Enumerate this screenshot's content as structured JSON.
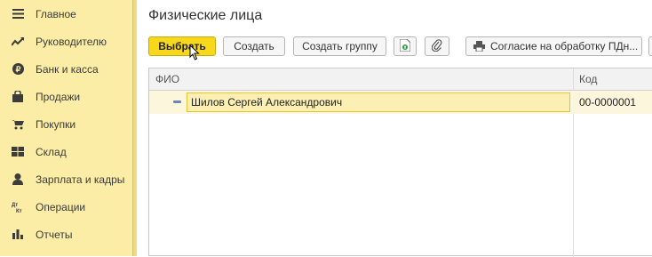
{
  "sidebar": {
    "items": [
      {
        "label": "Главное",
        "icon": "menu-icon"
      },
      {
        "label": "Руководителю",
        "icon": "trend-icon"
      },
      {
        "label": "Банк и касса",
        "icon": "coin-icon"
      },
      {
        "label": "Продажи",
        "icon": "bag-icon"
      },
      {
        "label": "Покупки",
        "icon": "cart-icon"
      },
      {
        "label": "Склад",
        "icon": "warehouse-icon"
      },
      {
        "label": "Зарплата и кадры",
        "icon": "person-icon"
      },
      {
        "label": "Операции",
        "icon": "operations-icon"
      },
      {
        "label": "Отчеты",
        "icon": "chart-icon"
      }
    ]
  },
  "page": {
    "title": "Физические лица"
  },
  "toolbar": {
    "select_label": "Выбрать",
    "create_label": "Создать",
    "create_group_label": "Создать группу",
    "consent_label": "Согласие на обработку ПДн..."
  },
  "table": {
    "columns": [
      "ФИО",
      "Код"
    ],
    "rows": [
      {
        "name": "Шилов Сергей Александрович",
        "code": "00-0000001"
      }
    ]
  },
  "colors": {
    "sidebar_bg": "#fbeca6",
    "primary_button": "#f8d81c",
    "selected_row": "#fcefb4"
  }
}
